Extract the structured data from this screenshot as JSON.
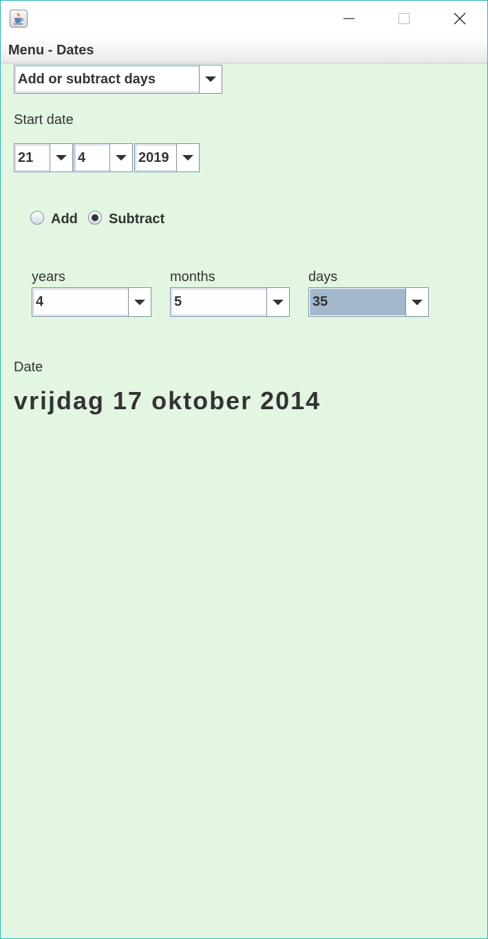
{
  "window": {
    "title_icon": "java-cup-icon",
    "controls": [
      "minimize-icon",
      "maximize-icon",
      "close-icon"
    ]
  },
  "menubar": {
    "title": "Menu - Dates"
  },
  "mode_select": {
    "value": "Add or subtract days"
  },
  "start_date": {
    "label": "Start date",
    "day": "21",
    "month": "4",
    "year": "2019"
  },
  "operation": {
    "add_label": "Add",
    "subtract_label": "Subtract",
    "selected": "Subtract"
  },
  "amount": {
    "years_label": "years",
    "years_value": "4",
    "months_label": "months",
    "months_value": "5",
    "days_label": "days",
    "days_value": "35"
  },
  "result": {
    "label": "Date",
    "value": "vrijdag 17 oktober 2014"
  },
  "colors": {
    "background": "#e2f6e2",
    "selected_field": "#a3b8cc",
    "window_border": "#2bb6b0"
  }
}
